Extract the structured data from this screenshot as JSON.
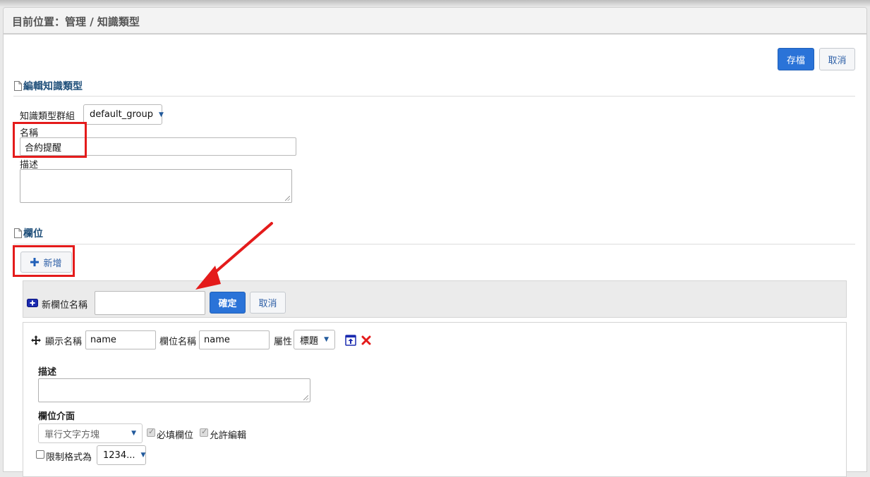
{
  "breadcrumb": "目前位置：管理 / 知識類型",
  "toolbar": {
    "save_label": "存檔",
    "cancel_label": "取消"
  },
  "edit_section": {
    "title": "編輯知識類型",
    "group_label": "知識類型群組",
    "group_value": "default_group",
    "name_label": "名稱",
    "name_value": "合約提醒",
    "desc_label": "描述"
  },
  "fields_section": {
    "title": "欄位",
    "add_label": "新增",
    "new_field": {
      "label": "新欄位名稱",
      "confirm_label": "確定",
      "cancel_label": "取消"
    },
    "field": {
      "display_name_label": "顯示名稱",
      "display_name_value": "name",
      "field_name_label": "欄位名稱",
      "field_name_value": "name",
      "attribute_label": "屬性",
      "attribute_value": "標題",
      "desc_label": "描述",
      "ui_label": "欄位介面",
      "ui_value": "單行文字方塊",
      "required_label": "必填欄位",
      "editable_label": "允許編輯",
      "format_label": "限制格式為",
      "format_value": "1234..."
    }
  },
  "colors": {
    "primary": "#2a73d8",
    "highlight": "#e41b1b",
    "title": "#1f4f7a"
  }
}
